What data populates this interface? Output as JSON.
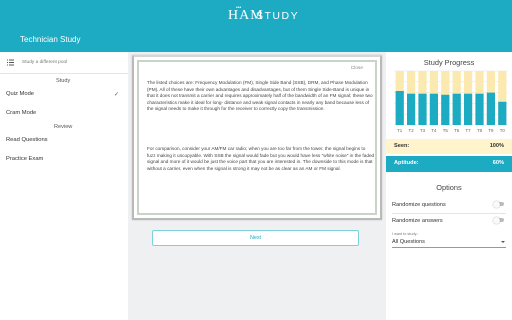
{
  "header": {
    "logo_dots": "•••",
    "logo_ham": "HAM",
    "logo_study": "STUDY",
    "app_title": "Technician Study"
  },
  "sidebar": {
    "pool_placeholder": "Study a different pool",
    "study_section": "Study",
    "quiz_mode": "Quiz Mode",
    "quiz_mode_check": "✓",
    "cram_mode": "Cram Mode",
    "review_section": "Review",
    "read_questions": "Read Questions",
    "practice_exam": "Practice Exam"
  },
  "card": {
    "close_label": "Close",
    "paragraph1": "The listed choices are: Frequency Modulation (FM), Single Side Band (SSB), DRM, and Phase Modulation (PM). All of these have their own advantages and disadvantages, but of them Single Side-Band is unique in that it does not transmit a carrier and requires approximately half of the bandwidth of an FM signal; these two characteristics make it ideal for long- distance and weak signal contacts in nearly any band because less of the signal needs to make it through for the receiver to correctly copy the transmission.",
    "paragraph2": "For comparison, consider your AM/FM car radio; when you are too far from the tower, the signal begins to fuzz making it uncopyable. With SSB the signal would fade but you would have less \"white noise\" in the faded signal and more of it would be just the voice part that you are interested in. The downside to this mode is that without a carrier, even when the signal is strong it may not be as clear as an AM or FM signal."
  },
  "next_label": "Next",
  "progress": {
    "title": "Study Progress",
    "seen_label": "Seen:",
    "seen_value": "100%",
    "aptitude_label": "Aptitude:",
    "aptitude_value": "60%"
  },
  "options": {
    "title": "Options",
    "randomize_questions": "Randomize questions",
    "randomize_questions_on": false,
    "randomize_answers": "Randomize answers",
    "randomize_answers_on": false,
    "study_caption": "I want to study...",
    "study_value": "All Questions"
  },
  "colors": {
    "accent": "#1dabc4",
    "seen_fill": "#fbe9b0",
    "grid": "#e2e2e2"
  },
  "chart_data": {
    "type": "bar",
    "categories": [
      "T1",
      "T2",
      "T3",
      "T4",
      "T5",
      "T6",
      "T7",
      "T8",
      "T9",
      "T0"
    ],
    "series": [
      {
        "values": [
          100,
          100,
          100,
          100,
          100,
          100,
          100,
          100,
          100,
          100
        ]
      },
      {
        "values": [
          63,
          58,
          58,
          58,
          56,
          58,
          58,
          58,
          60,
          43
        ]
      }
    ],
    "ylim": [
      0,
      100
    ],
    "grid": true
  }
}
